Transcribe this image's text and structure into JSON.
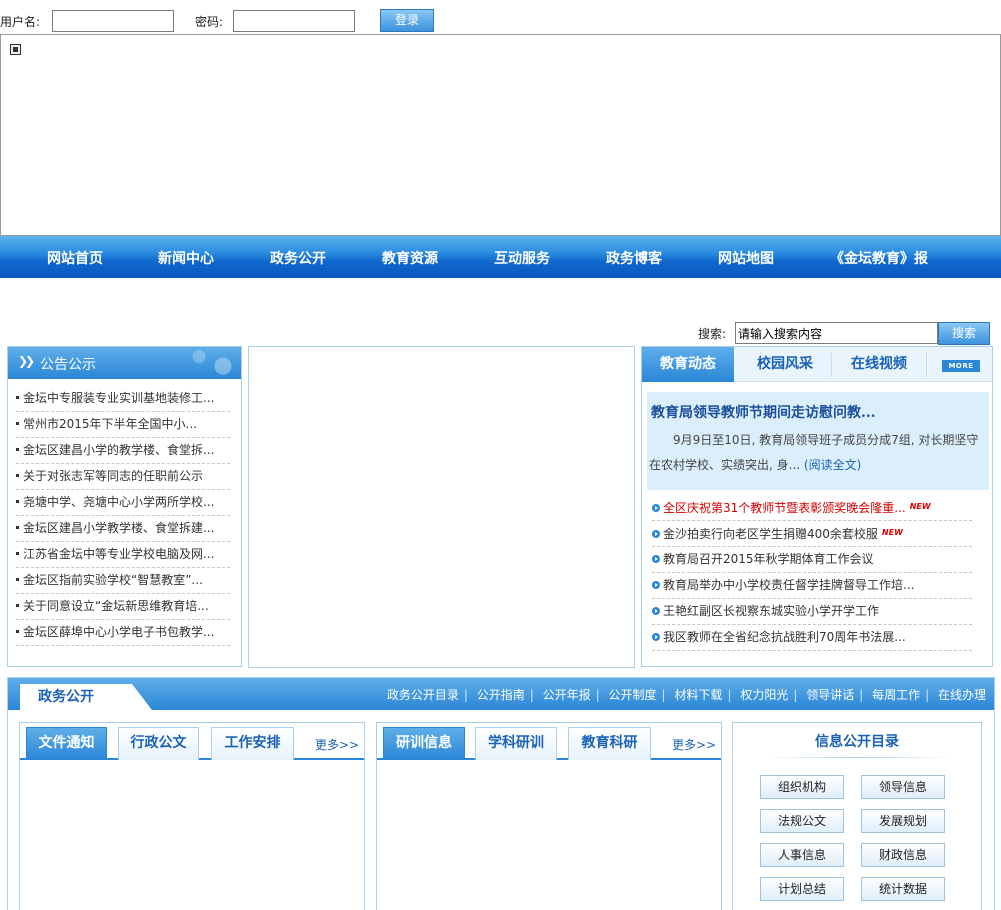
{
  "login": {
    "username_label": "用户名:",
    "password_label": "密码:",
    "username_value": "",
    "password_value": "",
    "submit_label": "登录"
  },
  "nav": {
    "items": [
      "网站首页",
      "新闻中心",
      "政务公开",
      "教育资源",
      "互动服务",
      "政务博客",
      "网站地图",
      "《金坛教育》报"
    ]
  },
  "search": {
    "label": "搜索:",
    "value": "请输入搜索内容",
    "button": "搜索"
  },
  "notice": {
    "title": "公告公示",
    "items": [
      "金坛中专服装专业实训基地装修工...",
      "常州市2015年下半年全国中小...",
      "金坛区建昌小学的教学楼、食堂拆...",
      "关于对张志军等同志的任职前公示",
      "尧塘中学、尧塘中心小学两所学校...",
      "金坛区建昌小学教学楼、食堂拆建...",
      "江苏省金坛中等专业学校电脑及网...",
      "金坛区指前实验学校“智慧教室”...",
      "关于同意设立“金坛新思维教育培...",
      "金坛区薛埠中心小学电子书包教学..."
    ]
  },
  "news": {
    "tabs": [
      "教育动态",
      "校园风采",
      "在线视频"
    ],
    "more": "MORE",
    "feature_title": "教育局领导教师节期间走访慰问教...",
    "feature_body": "9月9日至10日, 教育局领导班子成员分成7组, 对长期坚守在农村学校、实绩突出, 身...",
    "feature_link": "(阅读全文)",
    "new_badge": "NEW",
    "items": [
      "全区庆祝第31个教师节暨表彰颁奖晚会隆重...",
      "金沙拍卖行向老区学生捐赠400余套校服",
      "教育局召开2015年秋学期体育工作会议",
      "教育局举办中小学校责任督学挂牌督导工作培...",
      "王艳红副区长视察东城实验小学开学工作",
      "我区教师在全省纪念抗战胜利70周年书法展..."
    ]
  },
  "gov": {
    "title": "政务公开",
    "links": [
      "政务公开目录",
      "公开指南",
      "公开年报",
      "公开制度",
      "材料下载",
      "权力阳光",
      "领导讲话",
      "每周工作",
      "在线办理"
    ]
  },
  "panel1": {
    "tabs": [
      "文件通知",
      "行政公文",
      "工作安排"
    ],
    "more": "更多>>"
  },
  "panel2": {
    "tabs": [
      "研训信息",
      "学科研训",
      "教育科研"
    ],
    "more": "更多>>"
  },
  "info": {
    "title": "信息公开目录",
    "buttons": [
      "组织机构",
      "领导信息",
      "法规公文",
      "发展规划",
      "人事信息",
      "财政信息",
      "计划总结",
      "统计数据"
    ]
  }
}
